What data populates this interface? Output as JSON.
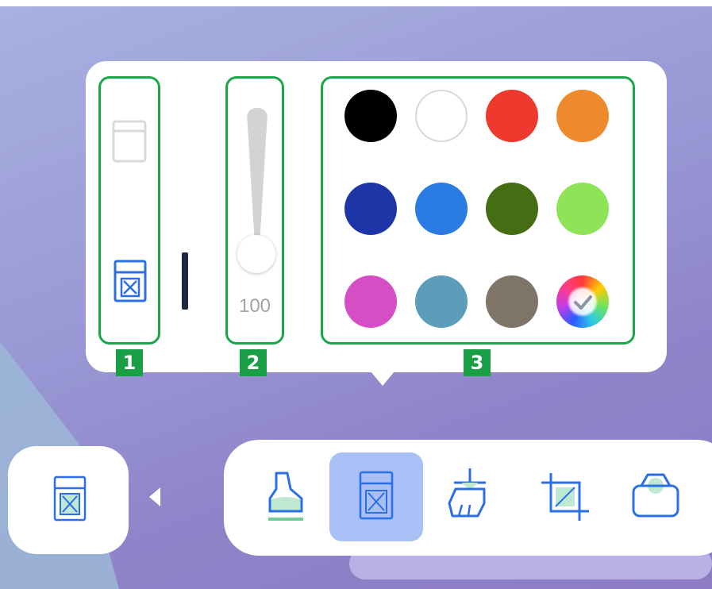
{
  "colors": {
    "highlight_border": "#1aa74a",
    "badge": "#1a9e46",
    "active_tool_bg": "#a9bff6",
    "icon_blue": "#2b6fe6",
    "icon_fill": "#bfe8d2"
  },
  "badges": {
    "b1": "1",
    "b2": "2",
    "b3": "3"
  },
  "modes": [
    {
      "name": "eraser-mode-rect-icon",
      "state": "disabled"
    },
    {
      "name": "eraser-mode-x-icon",
      "state": "selected"
    }
  ],
  "size_slider": {
    "value": "100"
  },
  "palette": {
    "swatches": [
      {
        "name": "black",
        "color": "#000000"
      },
      {
        "name": "white",
        "color": "#ffffff"
      },
      {
        "name": "red",
        "color": "#ee3a2e"
      },
      {
        "name": "orange",
        "color": "#ee8a2b"
      },
      {
        "name": "navy",
        "color": "#1e35a8"
      },
      {
        "name": "blue",
        "color": "#2a7be2"
      },
      {
        "name": "dark-green",
        "color": "#456e14"
      },
      {
        "name": "light-green",
        "color": "#8ee356"
      },
      {
        "name": "magenta",
        "color": "#d64ec6"
      },
      {
        "name": "steel-blue",
        "color": "#5b9dbb"
      },
      {
        "name": "taupe",
        "color": "#7e7567"
      },
      {
        "name": "custom-rainbow",
        "color": "rainbow"
      }
    ]
  },
  "toolbar": {
    "tools": [
      {
        "name": "highlighter-tool",
        "icon": "highlighter-icon",
        "active": false
      },
      {
        "name": "eraser-tool",
        "icon": "eraser-icon",
        "active": true
      },
      {
        "name": "clear-tool",
        "icon": "broom-icon",
        "active": false
      },
      {
        "name": "crop-tool",
        "icon": "crop-icon",
        "active": false
      },
      {
        "name": "shape-tool",
        "icon": "bag-icon",
        "active": false
      }
    ]
  }
}
